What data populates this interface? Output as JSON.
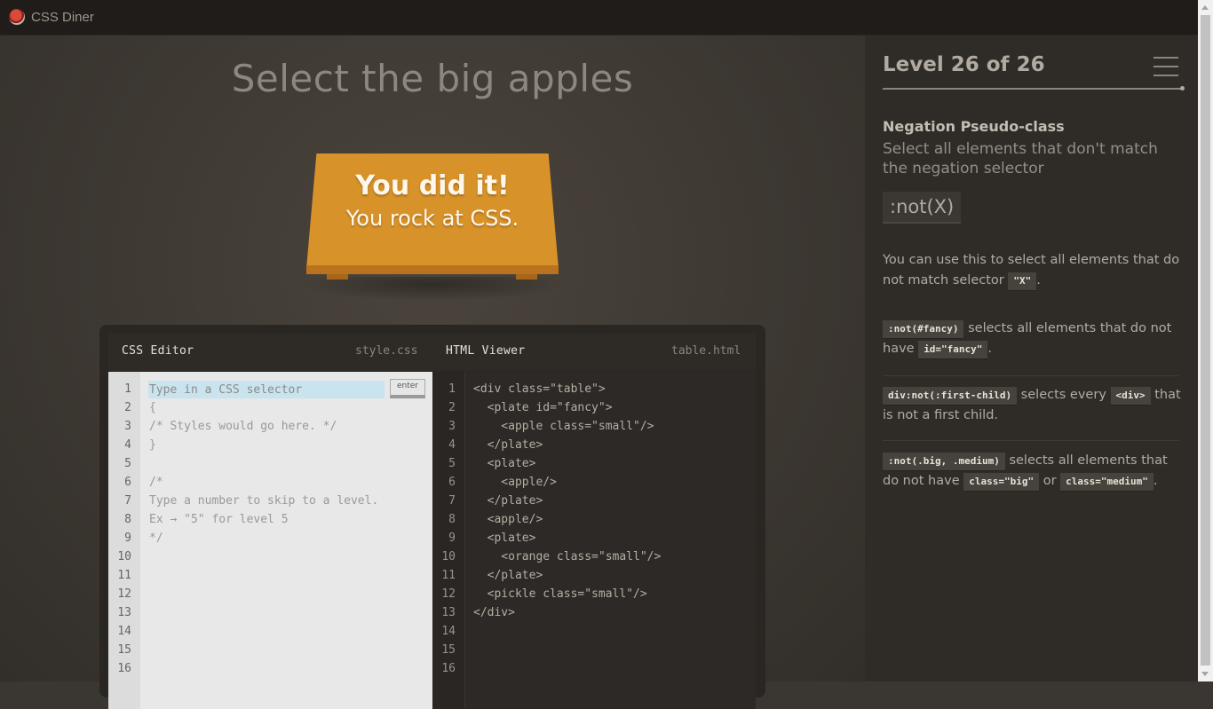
{
  "app": {
    "title": "CSS Diner",
    "logo_icon": "tomato-logo-icon"
  },
  "main": {
    "instruction": "Select the big apples",
    "success_title": "You did it!",
    "success_subtitle": "You rock at CSS."
  },
  "css_editor": {
    "title": "CSS Editor",
    "file": "style.css",
    "input_placeholder": "Type in a CSS selector",
    "enter_label": "enter",
    "line_numbers": [
      "1",
      "2",
      "3",
      "4",
      "5",
      "6",
      "7",
      "8",
      "9",
      "10",
      "11",
      "12",
      "13",
      "14",
      "15",
      "16"
    ],
    "lines": [
      "{",
      "/* Styles would go here. */",
      "}",
      "",
      "/*",
      "Type a number to skip to a level.",
      "Ex → \"5\" for level 5",
      "*/"
    ]
  },
  "html_viewer": {
    "title": "HTML Viewer",
    "file": "table.html",
    "line_numbers": [
      "1",
      "2",
      "3",
      "4",
      "5",
      "6",
      "7",
      "8",
      "9",
      "10",
      "11",
      "12",
      "13",
      "14",
      "15",
      "16"
    ],
    "lines": [
      "<div class=\"table\">",
      "  <plate id=\"fancy\">",
      "    <apple class=\"small\"/>",
      "  </plate>",
      "  <plate>",
      "    <apple/>",
      "  </plate>",
      "  <apple/>",
      "  <plate>",
      "    <orange class=\"small\"/>",
      "  </plate>",
      "  <pickle class=\"small\"/>",
      "</div>"
    ]
  },
  "sidebar": {
    "level_title": "Level 26 of 26",
    "progress": 1.0,
    "menu_icon": "hamburger-menu-icon",
    "selector_name": "Negation Pseudo-class",
    "selector_title": "Select all elements that don't match the negation selector",
    "syntax": ":not(X)",
    "hint_pre": "You can use this to select all elements that do not match selector ",
    "hint_tag": "\"X\"",
    "hint_post": ".",
    "examples": [
      {
        "code": ":not(#fancy)",
        "text1": " selects all elements that do not have ",
        "code2": "id=\"fancy\"",
        "text2": "."
      },
      {
        "code": "div:not(:first-child)",
        "text1": " selects every ",
        "code2": "<div>",
        "text2": " that is not a first child."
      },
      {
        "code": ":not(.big, .medium)",
        "text1": " selects all elements that do not have ",
        "code2": "class=\"big\"",
        "text2": " or ",
        "code3": "class=\"medium\"",
        "text3": "."
      }
    ]
  },
  "colors": {
    "table": "#d8922a",
    "input_highlight": "#c9e4ee",
    "background": "#3a3631"
  }
}
